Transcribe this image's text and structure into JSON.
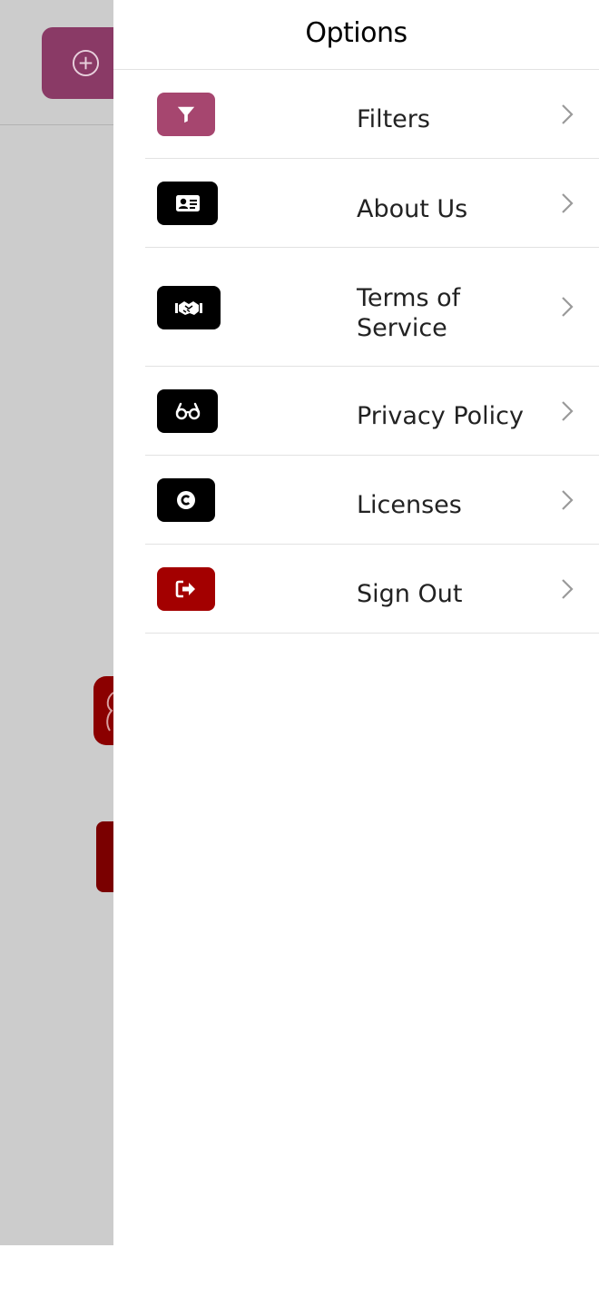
{
  "drawer": {
    "title": "Options",
    "items": [
      {
        "label": "Filters",
        "icon": "filter-icon",
        "color": "#a6466f"
      },
      {
        "label": "About Us",
        "icon": "id-card-icon",
        "color": "#000000"
      },
      {
        "label": "Terms of Service",
        "icon": "handshake-icon",
        "color": "#000000"
      },
      {
        "label": "Privacy Policy",
        "icon": "glasses-icon",
        "color": "#000000"
      },
      {
        "label": "Licenses",
        "icon": "copyright-icon",
        "color": "#000000"
      },
      {
        "label": "Sign Out",
        "icon": "sign-out-icon",
        "color": "#a30000"
      }
    ]
  },
  "background": {
    "add_button_icon": "plus-circle-icon",
    "overlay_color": "#cccccc"
  }
}
